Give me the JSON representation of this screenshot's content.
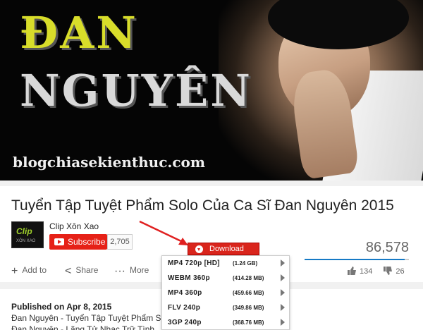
{
  "video": {
    "banner_line1": "ĐAN",
    "banner_line2": "NGUYÊN",
    "watermark": "blogchiasekienthuc.com"
  },
  "title": "Tuyển Tập Tuyệt Phẩm Solo Của Ca Sĩ Đan Nguyên 2015",
  "channel": {
    "logo_text": "Clip",
    "logo_subtext": "XÔN XAO",
    "name": "Clip Xôn Xao",
    "subscribe_label": "Subscribe",
    "subscriber_count": "2,705"
  },
  "views": "86,578",
  "actions": {
    "add_to": "Add to",
    "share": "Share",
    "more": "More",
    "likes": "134",
    "dislikes": "26"
  },
  "download": {
    "button_label": "Download",
    "options": [
      {
        "format": "MP4 720p [HD]",
        "size": "(1.24 GB)"
      },
      {
        "format": "WEBM 360p",
        "size": "(414.28 MB)"
      },
      {
        "format": "MP4 360p",
        "size": "(459.66 MB)"
      },
      {
        "format": "FLV 240p",
        "size": "(349.86 MB)"
      },
      {
        "format": "3GP 240p",
        "size": "(368.76 MB)"
      }
    ]
  },
  "description": {
    "published": "Published on Apr 8, 2015",
    "line1": "Đan Nguyên - Tuyển Tập Tuyệt Phẩm Solo",
    "line2": "Đan Nguyên - Lãng Tử Nhạc Trữ Tình"
  },
  "colors": {
    "subscribe_red": "#e62117",
    "download_red": "#d9251c",
    "view_bar_blue": "#167ac6"
  }
}
